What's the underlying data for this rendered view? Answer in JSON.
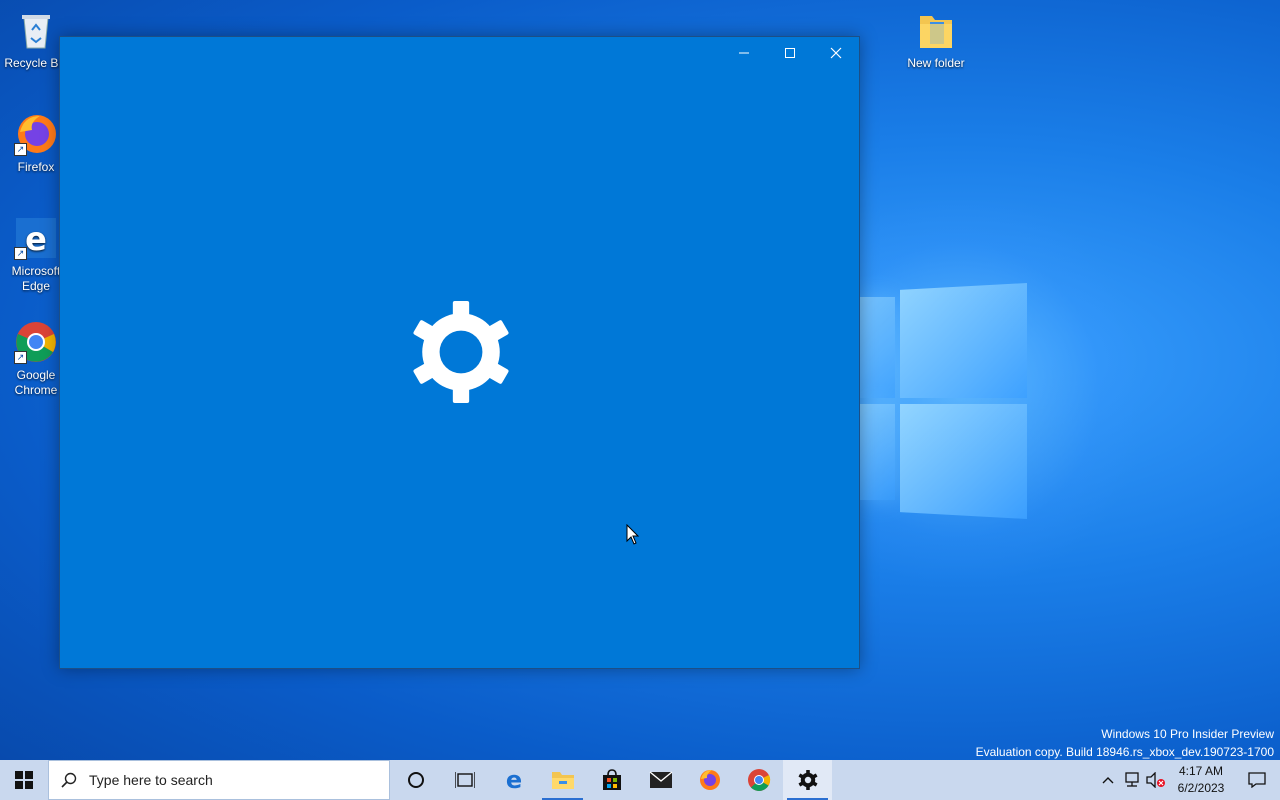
{
  "desktop": {
    "icons": [
      {
        "label": "Recycle Bin"
      },
      {
        "label": "Firefox"
      },
      {
        "label": "Microsoft Edge"
      },
      {
        "label": "Google Chrome"
      },
      {
        "label": "New folder"
      }
    ]
  },
  "window": {
    "minimize_label": "Minimize",
    "maximize_label": "Maximize",
    "close_label": "Close",
    "splash_icon": "gear-icon"
  },
  "watermark": {
    "line1": "Windows 10 Pro Insider Preview",
    "line2": "Evaluation copy. Build 18946.rs_xbox_dev.190723-1700"
  },
  "taskbar": {
    "search_placeholder": "Type here to search",
    "pinned": [
      "cortana",
      "task-view",
      "edge",
      "file-explorer",
      "store",
      "mail",
      "firefox",
      "chrome",
      "settings"
    ],
    "active_app": "settings",
    "clock": {
      "time": "4:17 AM",
      "date": "6/2/2023"
    }
  },
  "colors": {
    "window_bg": "#0078d7",
    "taskbar_bg": "#c9d8ee"
  }
}
